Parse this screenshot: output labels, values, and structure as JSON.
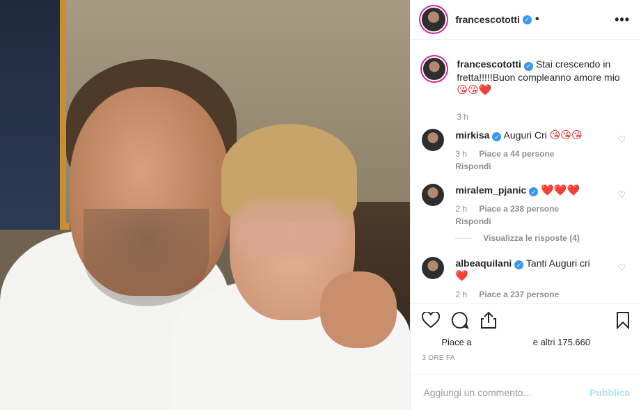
{
  "post": {
    "author": "francescototti",
    "follow_dot": "•",
    "more_icon": "•••"
  },
  "caption": {
    "username": "francescototti",
    "text": "Stai crescendo in fretta!!!!!Buon compleanno amore mio",
    "emojis": "😘😘❤️",
    "time": "3 h"
  },
  "comments": [
    {
      "username": "mirkisa",
      "verified": true,
      "text": "Auguri Cri",
      "emojis": "😘😘😘",
      "time": "3 h",
      "likes": "Piace a 44 persone",
      "reply": "Rispondi"
    },
    {
      "username": "miralem_pjanic",
      "verified": true,
      "text": "",
      "emojis": "❤️❤️❤️",
      "time": "2 h",
      "likes": "Piace a 238 persone",
      "reply": "Rispondi",
      "view_replies": "Visualizza le risposte (4)"
    },
    {
      "username": "albeaquilani",
      "verified": true,
      "text": "Tanti Auguri cri",
      "emojis": "❤️",
      "time": "2 h",
      "likes": "Piace a 237 persone"
    }
  ],
  "actions": {
    "likes_prefix": "Piace a",
    "likes_suffix": "e altri 175.660",
    "timestamp": "3 ORE FA"
  },
  "add_comment": {
    "placeholder": "Aggiungi un commento...",
    "post_label": "Pubblica"
  },
  "colors": {
    "verified": "#3897f0",
    "story_ring": "#d6249f",
    "post_button": "#b2dffc"
  }
}
